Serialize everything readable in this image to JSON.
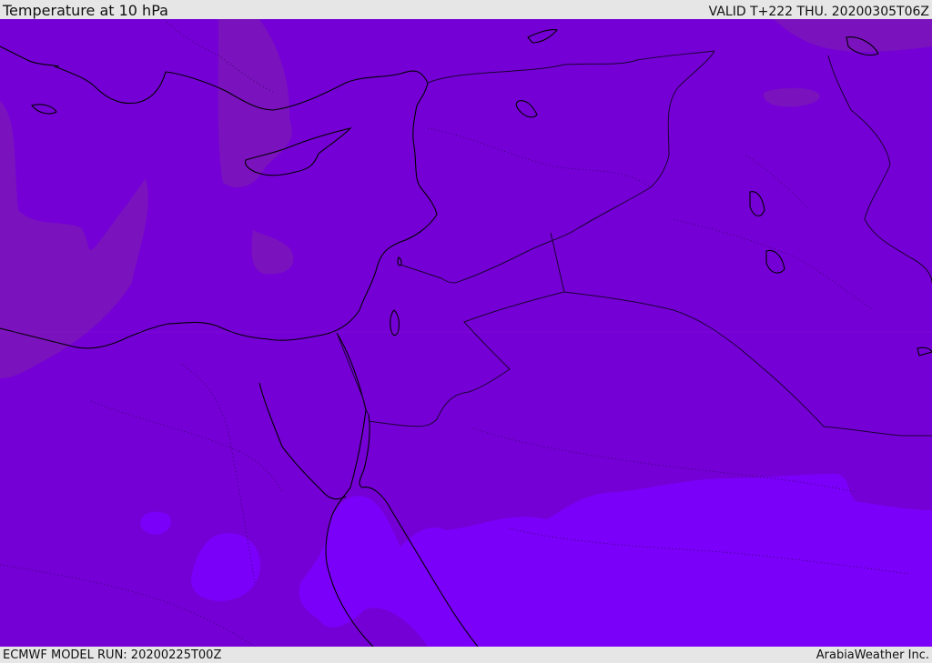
{
  "header": {
    "title": "Temperature at 10 hPa",
    "valid": "VALID T+222 THU. 20200305T06Z"
  },
  "footer": {
    "model_run": "ECMWF MODEL RUN: 20200225T00Z",
    "credit": "ArabiaWeather Inc."
  },
  "colors": {
    "base_field": "#7500d6",
    "warm_field": "#7a12bd",
    "cold_field": "#7b00f9",
    "coastline": "#000000",
    "border": "#1a0033"
  }
}
